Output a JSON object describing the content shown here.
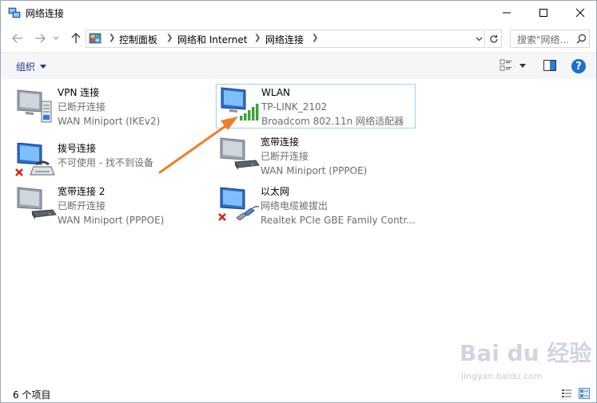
{
  "window": {
    "title": "网络连接"
  },
  "address": {
    "crumbs": [
      "控制面板",
      "网络和 Internet",
      "网络连接"
    ],
    "search_placeholder": "搜索\"网络..."
  },
  "toolbar": {
    "organize_label": "组织",
    "help_label": "?"
  },
  "items": [
    {
      "name": "VPN 连接",
      "status": "已断开连接",
      "device": "WAN Miniport (IKEv2)",
      "icon": "vpn-server-icon",
      "error": false
    },
    {
      "name": "WLAN",
      "status": "TP-LINK_2102",
      "device": "Broadcom 802.11n 网络适配器",
      "icon": "wifi-signal-icon",
      "error": false,
      "selected": true
    },
    {
      "name": "拨号连接",
      "status": "不可使用 - 找不到设备",
      "device": "",
      "icon": "modem-phone-icon",
      "error": true
    },
    {
      "name": "宽带连接",
      "status": "已断开连接",
      "device": "WAN Miniport (PPPOE)",
      "icon": "modem-icon",
      "error": false
    },
    {
      "name": "宽带连接 2",
      "status": "已断开连接",
      "device": "WAN Miniport (PPPOE)",
      "icon": "modem-icon",
      "error": false
    },
    {
      "name": "以太网",
      "status": "网络电缆被拔出",
      "device": "Realtek PCIe GBE Family Contr...",
      "icon": "ethernet-cable-icon",
      "error": true
    }
  ],
  "status": {
    "item_count": "6 个项目"
  },
  "watermark": {
    "logo": "Bai du 经验",
    "sub": "jingyan.baidu.com"
  },
  "colors": {
    "accent": "#1a6fd0",
    "arrow": "#f07d2c",
    "selection_border": "#99d1ff",
    "error_red": "#e0201b",
    "signal_green": "#3aa33a"
  }
}
